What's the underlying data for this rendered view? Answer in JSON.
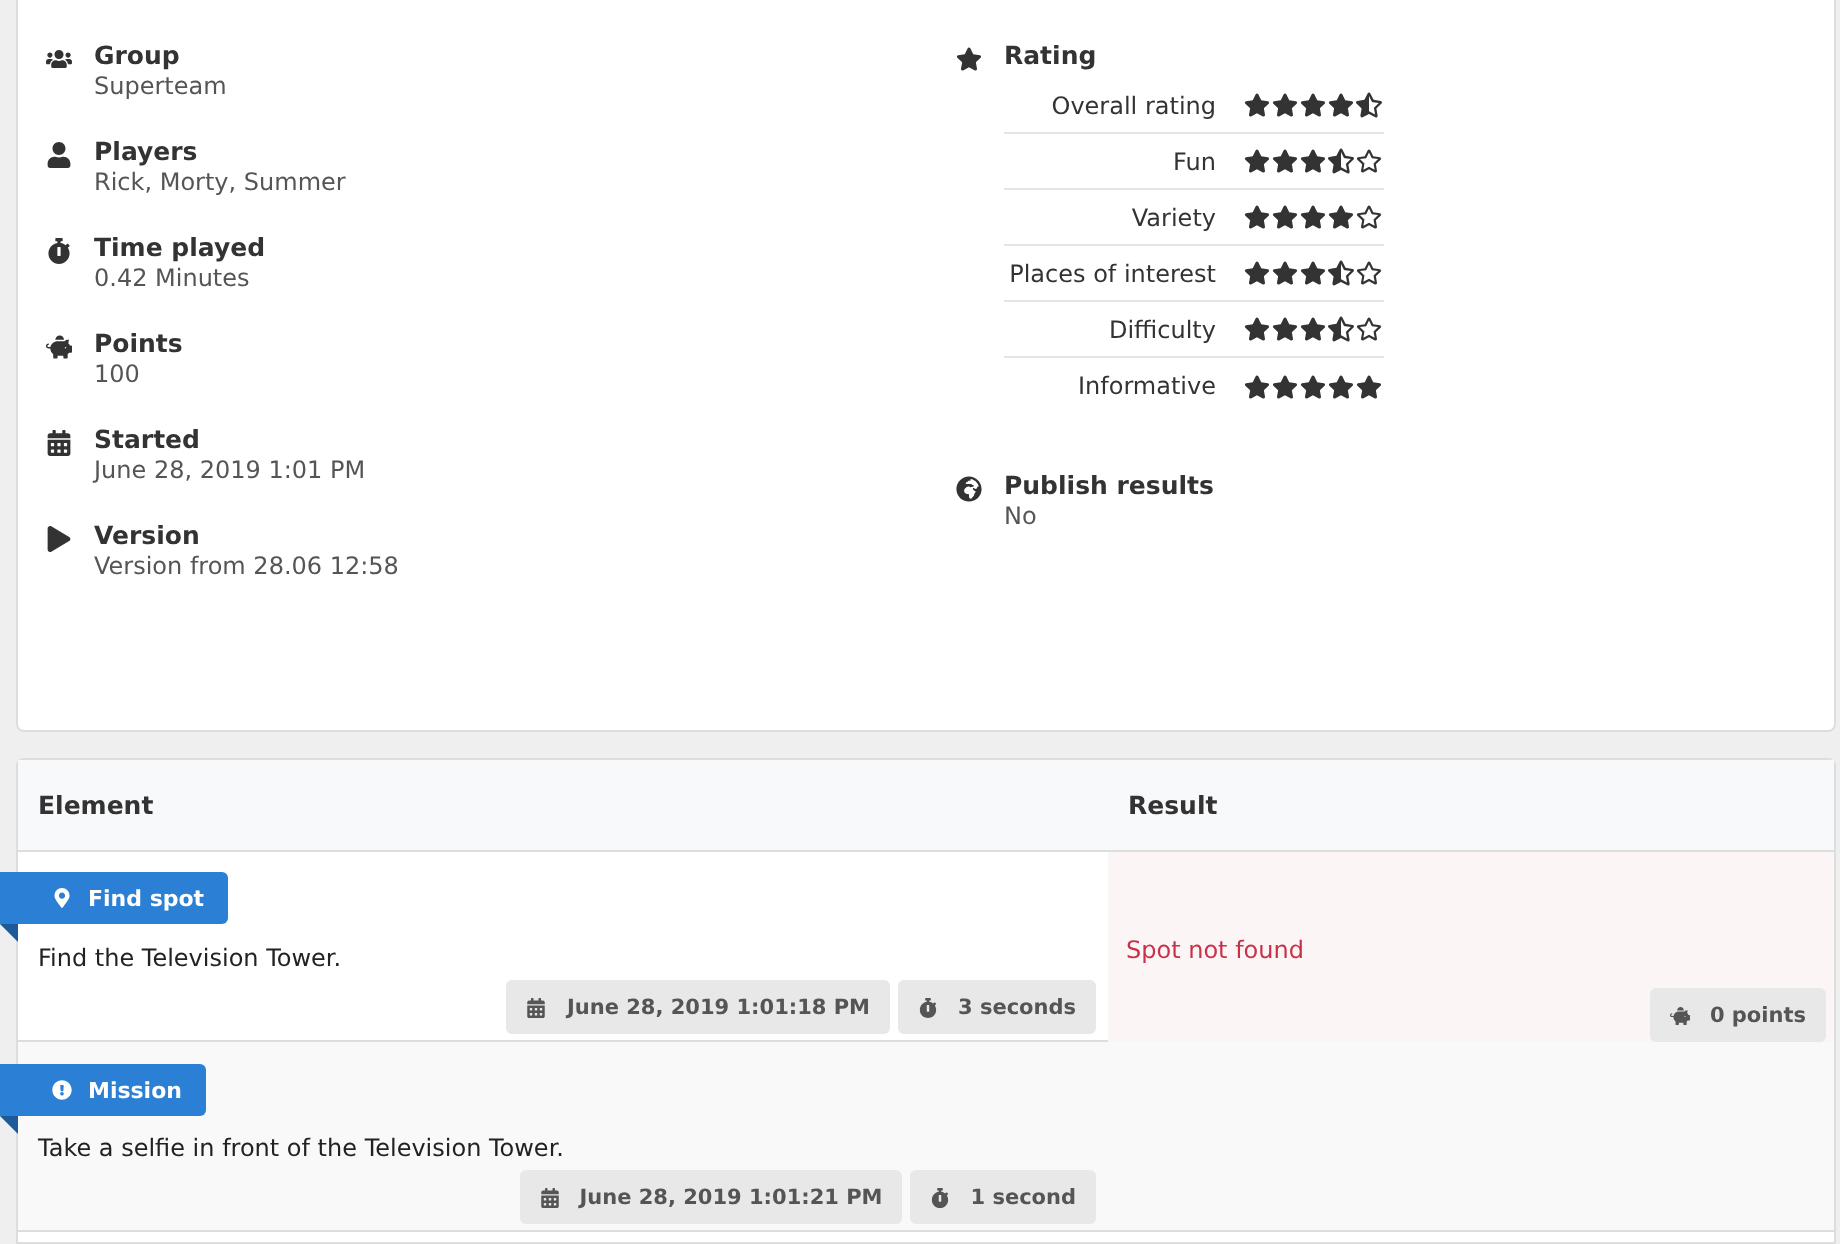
{
  "details": [
    {
      "kind": "group",
      "label": "Group",
      "value": "Superteam"
    },
    {
      "kind": "players",
      "label": "Players",
      "value": "Rick, Morty, Summer"
    },
    {
      "kind": "time",
      "label": "Time played",
      "value": "0.42 Minutes"
    },
    {
      "kind": "points",
      "label": "Points",
      "value": "100"
    },
    {
      "kind": "started",
      "label": "Started",
      "value": "June 28, 2019 1:01 PM"
    },
    {
      "kind": "version",
      "label": "Version",
      "value": "Version from 28.06 12:58"
    }
  ],
  "rating": {
    "label": "Rating",
    "items": [
      {
        "name": "Overall rating",
        "stars": 4.5
      },
      {
        "name": "Fun",
        "stars": 3.5
      },
      {
        "name": "Variety",
        "stars": 4
      },
      {
        "name": "Places of interest",
        "stars": 3.5
      },
      {
        "name": "Difficulty",
        "stars": 3.5
      },
      {
        "name": "Informative",
        "stars": 5
      }
    ]
  },
  "publish": {
    "label": "Publish results",
    "value": "No"
  },
  "table": {
    "columns": [
      "Element",
      "Result"
    ],
    "rows": [
      {
        "kind": "spot",
        "tag": "Find spot",
        "text": "Find the Television Tower.",
        "meta": [
          {
            "kind": "date",
            "text": "June 28, 2019 1:01:18 PM"
          },
          {
            "kind": "duration",
            "text": "3 seconds"
          }
        ],
        "result": {
          "found": false,
          "text": "Spot not found",
          "points": "0 points"
        }
      },
      {
        "kind": "mission",
        "tag": "Mission",
        "text": "Take a selfie in front of the Television Tower.",
        "meta": [
          {
            "kind": "date",
            "text": "June 28, 2019 1:01:21 PM"
          },
          {
            "kind": "duration",
            "text": "1 second"
          }
        ]
      }
    ]
  }
}
